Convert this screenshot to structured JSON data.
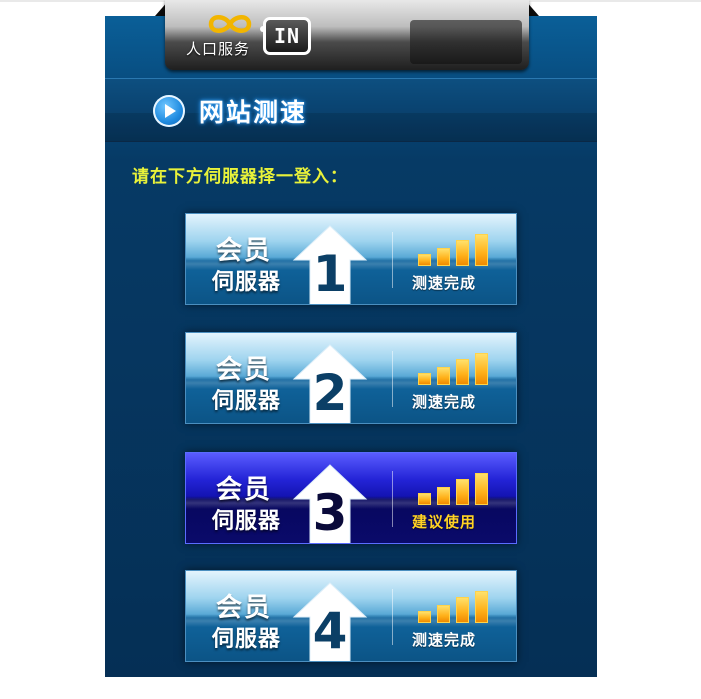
{
  "header": {
    "logo_text": "人口服务",
    "badge_text": "IN"
  },
  "section": {
    "title": "网站测速",
    "instruction": "请在下方伺服器择一登入："
  },
  "servers": [
    {
      "label_line1": "会员",
      "label_line2": "伺服器",
      "number": "1",
      "status": "测速完成",
      "recommended": false,
      "signal_level": 4
    },
    {
      "label_line1": "会员",
      "label_line2": "伺服器",
      "number": "2",
      "status": "测速完成",
      "recommended": false,
      "signal_level": 4
    },
    {
      "label_line1": "会员",
      "label_line2": "伺服器",
      "number": "3",
      "status": "建议使用",
      "recommended": true,
      "signal_level": 4
    },
    {
      "label_line1": "会员",
      "label_line2": "伺服器",
      "number": "4",
      "status": "测速完成",
      "recommended": false,
      "signal_level": 4
    }
  ],
  "icons": {
    "logo": "infinity-logo-icon",
    "title": "play-icon",
    "server": "up-arrow-icon",
    "signal": "signal-bars-icon"
  },
  "colors": {
    "panel": "#063a65",
    "instruction": "#e8f23a",
    "recommended_status": "#ffd224",
    "signal": "#ffb11a"
  }
}
